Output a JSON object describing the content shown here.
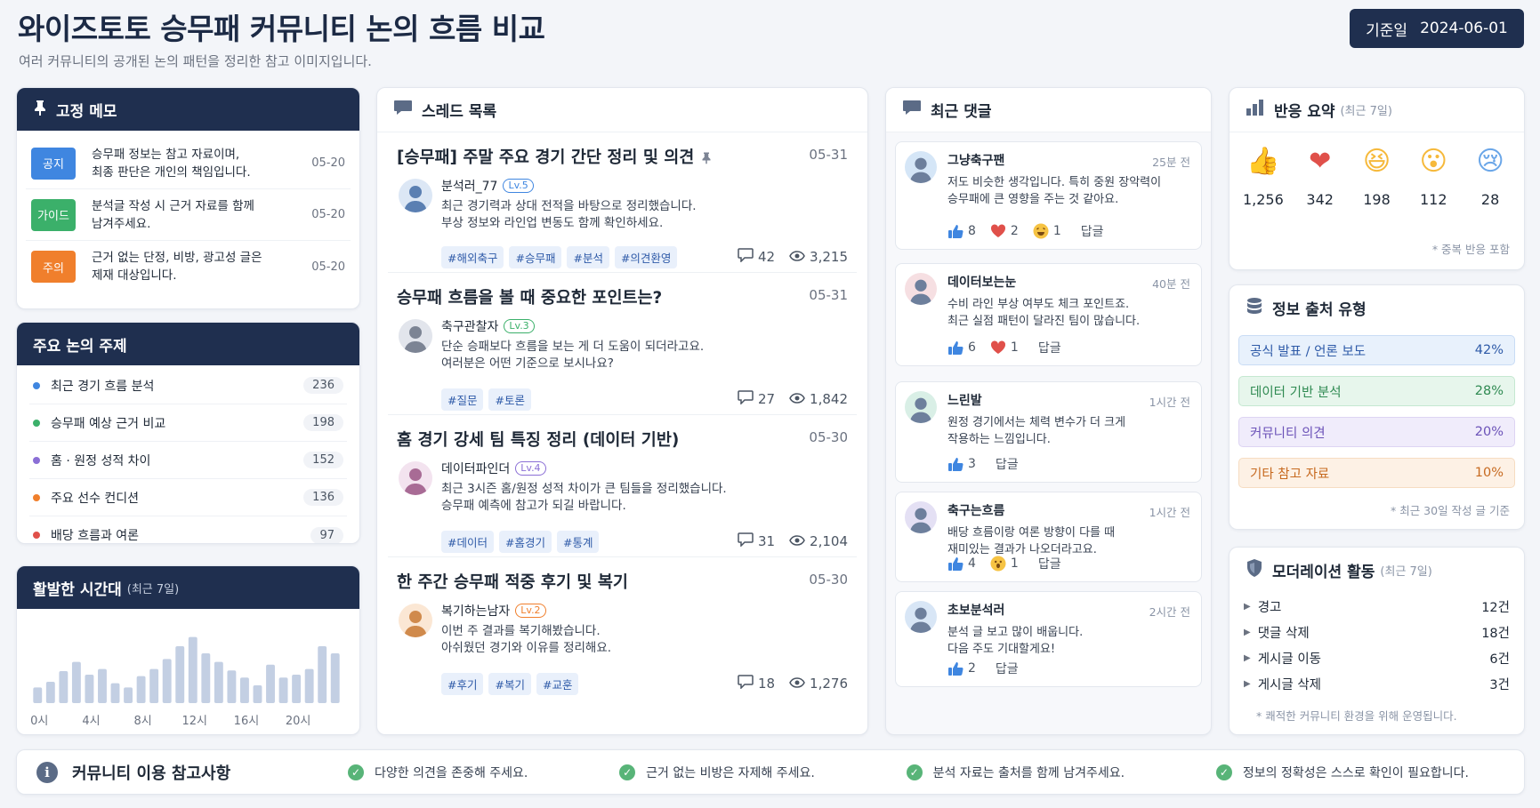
{
  "header": {
    "title": "와이즈토토 승무패 커뮤니티 논의 흐름 비교",
    "subtitle": "여러 커뮤니티의 공개된 논의 패턴을 정리한 참고 이미지입니다.",
    "date_label": "기준일",
    "date_value": "2024-06-01"
  },
  "pinned": {
    "title": "고정 메모",
    "items": [
      {
        "tag": "공지",
        "tag_color": "#3f86e0",
        "text": "승무패 정보는 참고 자료이며,\n최종 판단은 개인의 책임입니다.",
        "date": "05-20"
      },
      {
        "tag": "가이드",
        "tag_color": "#3bb06a",
        "text": "분석글 작성 시 근거 자료를 함께\n남겨주세요.",
        "date": "05-20"
      },
      {
        "tag": "주의",
        "tag_color": "#f07f2c",
        "text": "근거 없는 단정, 비방, 광고성 글은\n제재 대상입니다.",
        "date": "05-20"
      }
    ]
  },
  "topics": {
    "title": "주요 논의 주제",
    "items": [
      {
        "label": "최근 경기 흐름 분석",
        "count": "236",
        "color": "#3f86e0"
      },
      {
        "label": "승무패 예상 근거 비교",
        "count": "198",
        "color": "#3bb06a"
      },
      {
        "label": "홈 · 원정 성적 차이",
        "count": "152",
        "color": "#8b6fd6"
      },
      {
        "label": "주요 선수 컨디션",
        "count": "136",
        "color": "#f07f2c"
      },
      {
        "label": "배당 흐름과 여론",
        "count": "97",
        "color": "#e0504a"
      }
    ]
  },
  "activity": {
    "title": "활발한 시간대",
    "period": "(최근 7일)",
    "axis_labels": [
      "0시",
      "4시",
      "8시",
      "12시",
      "16시",
      "20시"
    ]
  },
  "chart_data": {
    "type": "bar",
    "title": "활발한 시간대",
    "subtitle": "(최근 7일)",
    "categories": [
      "0",
      "1",
      "2",
      "3",
      "4",
      "5",
      "6",
      "7",
      "8",
      "9",
      "10",
      "11",
      "12",
      "13",
      "14",
      "15",
      "16",
      "17",
      "18",
      "19",
      "20",
      "21",
      "22",
      "23"
    ],
    "x_tick_labels": [
      "0시",
      "4시",
      "8시",
      "12시",
      "16시",
      "20시"
    ],
    "values": [
      22,
      30,
      45,
      58,
      40,
      48,
      28,
      22,
      38,
      48,
      62,
      80,
      93,
      70,
      58,
      46,
      36,
      25,
      54,
      36,
      40,
      48,
      80,
      70
    ],
    "ylim": [
      0,
      100
    ],
    "grid": false,
    "color": "#c3cfe3"
  },
  "threads": {
    "title": "스레드 목록",
    "items": [
      {
        "title": "[승무패] 주말 주요 경기 간단 정리 및 의견",
        "pinned": true,
        "date": "05-31",
        "author": "분석러_77",
        "level": "Lv.5",
        "level_color": "#3f86e0",
        "avatar_color": "#dce7f5",
        "avatar_fg": "#5a7fb2",
        "body": "최근 경기력과 상대 전적을 바탕으로 정리했습니다.\n부상 정보와 라인업 변동도 함께 확인하세요.",
        "tags": [
          "#해외축구",
          "#승무패",
          "#분석",
          "#의견환영"
        ],
        "comments": "42",
        "views": "3,215"
      },
      {
        "title": "승무패 흐름을 볼 때 중요한 포인트는?",
        "pinned": false,
        "date": "05-31",
        "author": "축구관찰자",
        "level": "Lv.3",
        "level_color": "#3bb06a",
        "avatar_color": "#e2e5ec",
        "avatar_fg": "#7c8494",
        "body": "단순 승패보다 흐름을 보는 게 더 도움이 되더라고요.\n여러분은 어떤 기준으로 보시나요?",
        "tags": [
          "#질문",
          "#토론"
        ],
        "comments": "27",
        "views": "1,842"
      },
      {
        "title": "홈 경기 강세 팀 특징 정리 (데이터 기반)",
        "pinned": false,
        "date": "05-30",
        "author": "데이터파인더",
        "level": "Lv.4",
        "level_color": "#8b6fd6",
        "avatar_color": "#f3e3ef",
        "avatar_fg": "#a86b95",
        "body": "최근 3시즌 홈/원정 성적 차이가 큰 팀들을 정리했습니다.\n승무패 예측에 참고가 되길 바랍니다.",
        "tags": [
          "#데이터",
          "#홈경기",
          "#통계"
        ],
        "comments": "31",
        "views": "2,104"
      },
      {
        "title": "한 주간 승무패 적중 후기 및 복기",
        "pinned": false,
        "date": "05-30",
        "author": "복기하는남자",
        "level": "Lv.2",
        "level_color": "#f07f2c",
        "avatar_color": "#fbe7d4",
        "avatar_fg": "#d08a4c",
        "body": "이번 주 결과를 복기해봤습니다.\n아쉬웠던 경기와 이유를 정리해요.",
        "tags": [
          "#후기",
          "#복기",
          "#교훈"
        ],
        "comments": "18",
        "views": "1,276"
      }
    ]
  },
  "comments": {
    "title": "최근 댓글",
    "reply_label": "답글",
    "items": [
      {
        "name": "그냥축구팬",
        "time": "25분 전",
        "text": "저도 비슷한 생각입니다. 특히 중원 장악력이\n승무패에 큰 영향을 주는 것 같아요.",
        "avatar_color": "#d5e6f7",
        "likes": "8",
        "hearts": "2",
        "laughs": "1",
        "wows": ""
      },
      {
        "name": "데이터보는눈",
        "time": "40분 전",
        "text": "수비 라인 부상 여부도 체크 포인트죠.\n최근 실점 패턴이 달라진 팀이 많습니다.",
        "avatar_color": "#f6dfe2",
        "likes": "6",
        "hearts": "1",
        "laughs": "",
        "wows": ""
      },
      {
        "name": "느린발",
        "time": "1시간 전",
        "text": "원정 경기에서는 체력 변수가 더 크게\n작용하는 느낌입니다.",
        "avatar_color": "#d9efe6",
        "likes": "3",
        "hearts": "",
        "laughs": "",
        "wows": ""
      },
      {
        "name": "축구는흐름",
        "time": "1시간 전",
        "text": "배당 흐름이랑 여론 방향이 다를 때\n재미있는 결과가 나오더라고요.",
        "avatar_color": "#e4e0f4",
        "likes": "4",
        "hearts": "",
        "laughs": "",
        "wows": "1"
      },
      {
        "name": "초보분석러",
        "time": "2시간 전",
        "text": "분석 글 보고 많이 배웁니다.\n다음 주도 기대할게요!",
        "avatar_color": "#d8e6f6",
        "likes": "2",
        "hearts": "",
        "laughs": "",
        "wows": ""
      }
    ]
  },
  "reactions": {
    "title": "반응 요약",
    "period": "(최근 7일)",
    "note": "* 중복 반응 포함",
    "items": [
      {
        "icon": "thumbs-up-icon",
        "glyph": "👍",
        "value": "1,256"
      },
      {
        "icon": "heart-icon",
        "glyph": "❤",
        "value": "342"
      },
      {
        "icon": "laugh-icon",
        "glyph": "😆",
        "value": "198"
      },
      {
        "icon": "wow-icon",
        "glyph": "😮",
        "value": "112"
      },
      {
        "icon": "sad-icon",
        "glyph": "😢",
        "value": "28"
      }
    ]
  },
  "sources": {
    "title": "정보 출처 유형",
    "note": "* 최근 30일 작성 글 기준",
    "items": [
      {
        "label": "공식 발표 / 언론 보도",
        "value": "42%",
        "bg": "#e8f1fc",
        "border": "#c9dcf5",
        "fg": "#2e5aa8"
      },
      {
        "label": "데이터 기반 분석",
        "value": "28%",
        "bg": "#e7f6ec",
        "border": "#c5e8d1",
        "fg": "#2f8a52"
      },
      {
        "label": "커뮤니티 의견",
        "value": "20%",
        "bg": "#f0ecfb",
        "border": "#ddd4f3",
        "fg": "#6b52b8"
      },
      {
        "label": "기타 참고 자료",
        "value": "10%",
        "bg": "#fdf1e5",
        "border": "#f6dcc1",
        "fg": "#c76a20"
      }
    ]
  },
  "moderation": {
    "title": "모더레이션 활동",
    "period": "(최근 7일)",
    "note": "* 쾌적한 커뮤니티 환경을 위해 운영됩니다.",
    "items": [
      {
        "label": "경고",
        "value": "12건"
      },
      {
        "label": "댓글 삭제",
        "value": "18건"
      },
      {
        "label": "게시글 이동",
        "value": "6건"
      },
      {
        "label": "게시글 삭제",
        "value": "3건"
      }
    ]
  },
  "footer": {
    "title": "커뮤니티 이용 참고사항",
    "notes": [
      "다양한 의견을 존중해 주세요.",
      "근거 없는 비방은 자제해 주세요.",
      "분석 자료는 출처를 함께 남겨주세요.",
      "정보의 정확성은 스스로 확인이 필요합니다."
    ]
  }
}
